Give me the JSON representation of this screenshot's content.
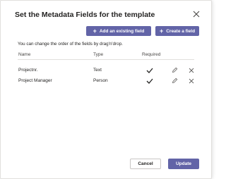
{
  "dialog": {
    "title": "Set the Metadata Fields for the template",
    "add_existing_label": "Add an existing field",
    "create_label": "Create a field",
    "hint": "You can change the order of the fields by drag'n'drop.",
    "columns": {
      "name": "Name",
      "type": "Type",
      "required": "Required"
    },
    "rows": [
      {
        "name": "Projectnr.",
        "type": "Text",
        "required": true
      },
      {
        "name": "Project Manager",
        "type": "Person",
        "required": true
      }
    ],
    "cancel_label": "Cancel",
    "update_label": "Update"
  },
  "colors": {
    "accent": "#6264a7",
    "text": "#252423",
    "border": "#c8c6c4"
  },
  "icons": {
    "close": "close-icon",
    "plus": "plus-icon",
    "check": "check-icon",
    "edit": "pencil-icon",
    "delete": "close-icon"
  }
}
